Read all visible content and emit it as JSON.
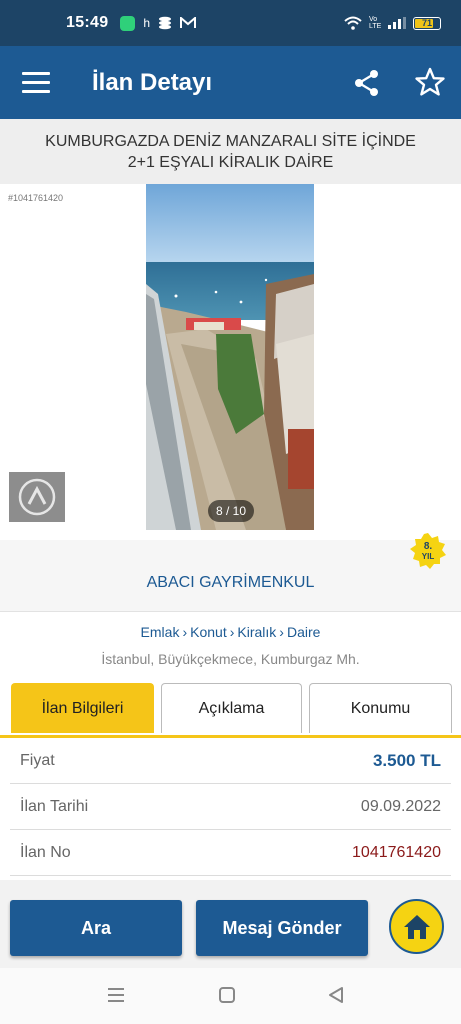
{
  "status_bar": {
    "time": "15:49",
    "notif_h": "h",
    "battery": "71",
    "volte": "Vo LTE"
  },
  "app_bar": {
    "title": "İlan Detayı"
  },
  "listing": {
    "title_line1": "KUMBURGAZDA DENİZ MANZARALI SİTE İÇİNDE",
    "title_line2": "2+1 EŞYALI KİRALIK DAİRE",
    "id_small": "#1041761420",
    "photo_counter": "8 / 10"
  },
  "agency": {
    "name": "ABACI GAYRİMENKUL",
    "years_badge_num": "8.",
    "years_badge_text": "YIL"
  },
  "breadcrumb": {
    "items": [
      "Emlak",
      "Konut",
      "Kiralık",
      "Daire"
    ],
    "separator": "›"
  },
  "location": "İstanbul, Büyükçekmece, Kumburgaz Mh.",
  "tabs": [
    {
      "label": "İlan Bilgileri",
      "active": true
    },
    {
      "label": "Açıklama",
      "active": false
    },
    {
      "label": "Konumu",
      "active": false
    }
  ],
  "info": [
    {
      "label": "Fiyat",
      "value": "3.500 TL"
    },
    {
      "label": "İlan Tarihi",
      "value": "09.09.2022"
    },
    {
      "label": "İlan No",
      "value": "1041761420"
    }
  ],
  "actions": {
    "call_label": "Ara",
    "message_label": "Mesaj Gönder"
  },
  "colors": {
    "header": "#1d5a93",
    "status": "#1d4466",
    "accent": "#f5c518",
    "id_red": "#8b1a1a"
  }
}
